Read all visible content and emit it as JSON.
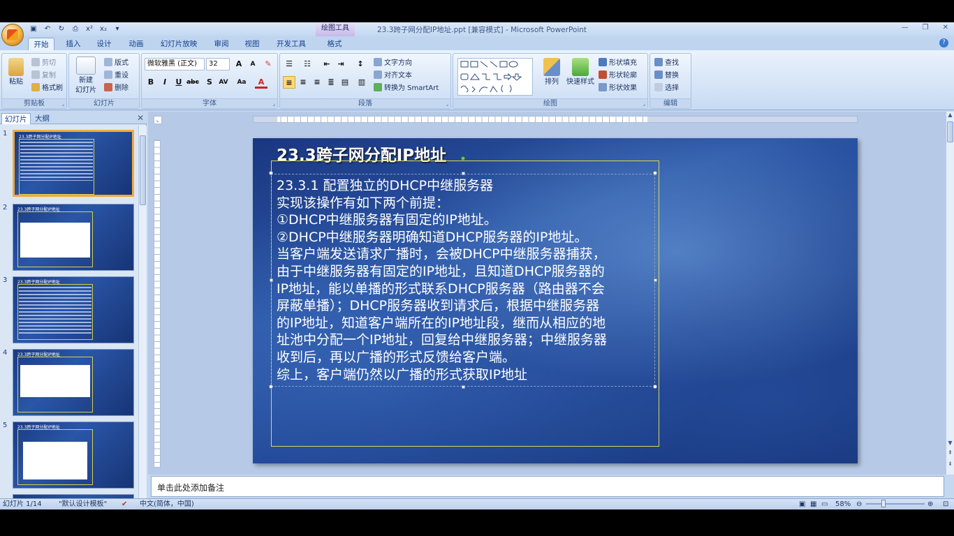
{
  "window": {
    "title": "23.3跨子网分配IP地址.ppt [兼容模式] - Microsoft PowerPoint",
    "context_tab_header": "绘图工具"
  },
  "tabs": [
    {
      "label": "开始",
      "active": true
    },
    {
      "label": "插入"
    },
    {
      "label": "设计"
    },
    {
      "label": "动画"
    },
    {
      "label": "幻灯片放映"
    },
    {
      "label": "审阅"
    },
    {
      "label": "视图"
    },
    {
      "label": "开发工具"
    },
    {
      "label": "格式"
    }
  ],
  "ribbon": {
    "clipboard": {
      "label": "剪贴板",
      "paste": "粘贴",
      "cut": "剪切",
      "copy": "复制",
      "format_painter": "格式刷"
    },
    "slides": {
      "label": "幻灯片",
      "new_slide_1": "新建",
      "new_slide_2": "幻灯片",
      "layout": "版式",
      "reset": "重设",
      "delete": "删除"
    },
    "font": {
      "label": "字体",
      "font_name": "微软雅黑 (正文)",
      "font_size": "32"
    },
    "paragraph": {
      "label": "段落",
      "text_direction": "文字方向",
      "align_text": "对齐文本",
      "convert_smartart": "转换为 SmartArt"
    },
    "drawing": {
      "label": "绘图",
      "arrange": "排列",
      "quick_styles": "快速样式",
      "shape_fill": "形状填充",
      "shape_outline": "形状轮廓",
      "shape_effects": "形状效果"
    },
    "editing": {
      "label": "编辑",
      "find": "查找",
      "replace": "替换",
      "select": "选择"
    }
  },
  "left_panel": {
    "tab_slides": "幻灯片",
    "tab_outline": "大纲",
    "thumbnails": [
      {
        "num": "1",
        "title": "23.3跨子网分配IP地址",
        "selected": true
      },
      {
        "num": "2",
        "title": "23.3跨子网分配IP地址"
      },
      {
        "num": "3",
        "title": "23.3跨子网分配IP地址"
      },
      {
        "num": "4",
        "title": "23.3跨子网分配IP地址"
      },
      {
        "num": "5",
        "title": "23.3跨子网分配IP地址"
      }
    ]
  },
  "slide": {
    "title": "23.3跨子网分配IP地址",
    "body_lines": [
      "23.3.1 配置独立的DHCP中继服务器",
      "实现该操作有如下两个前提：",
      "①DHCP中继服务器有固定的IP地址。",
      "②DHCP中继服务器明确知道DHCP服务器的IP地址。",
      "当客户端发送请求广播时，会被DHCP中继服务器捕获，",
      "由于中继服务器有固定的IP地址，且知道DHCP服务器的",
      "IP地址，能以单播的形式联系DHCP服务器（路由器不会",
      "屏蔽单播）；DHCP服务器收到请求后，根据中继服务器",
      "的IP地址，知道客户端所在的IP地址段，继而从相应的地",
      "址池中分配一个IP地址，回复给中继服务器；中继服务器",
      "收到后，再以广播的形式反馈给客户端。",
      "综上，客户端仍然以广播的形式获取IP地址"
    ]
  },
  "notes": {
    "placeholder": "单击此处添加备注"
  },
  "statusbar": {
    "slide_count": "幻灯片 1/14",
    "theme": "\"默认设计模板\"",
    "language": "中文(简体，中国)",
    "zoom": "58%"
  },
  "colors": {
    "slide_bg": "#1f4391",
    "selection_border": "#d8d85a",
    "ribbon_bg": "#dbe8f8"
  }
}
